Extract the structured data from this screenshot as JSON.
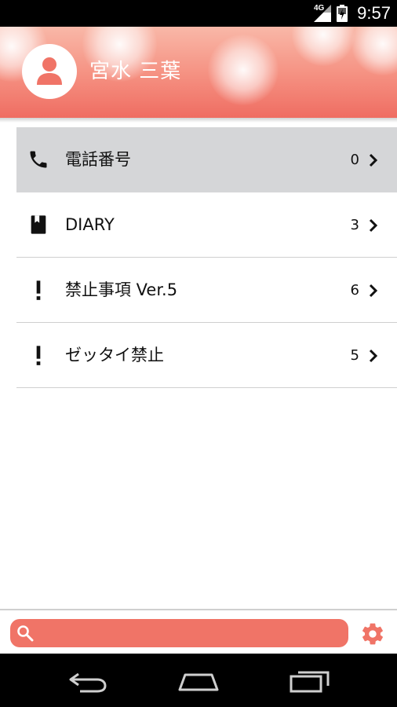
{
  "status_bar": {
    "network": "4G",
    "time": "9:57"
  },
  "header": {
    "user_name": "宮水 三葉",
    "avatar_icon": "person-icon"
  },
  "list": {
    "items": [
      {
        "icon": "phone-icon",
        "label": "電話番号",
        "count": "0",
        "selected": true
      },
      {
        "icon": "book-icon",
        "label": "DIARY",
        "count": "3",
        "selected": false
      },
      {
        "icon": "exclamation-icon",
        "label": "禁止事項 Ver.5",
        "count": "6",
        "selected": false
      },
      {
        "icon": "exclamation-icon",
        "label": "ゼッタイ禁止",
        "count": "5",
        "selected": false
      }
    ]
  },
  "bottom_bar": {
    "search_value": "",
    "search_placeholder": ""
  },
  "colors": {
    "accent": "#f07467",
    "selected_row": "#d5d6d8"
  }
}
